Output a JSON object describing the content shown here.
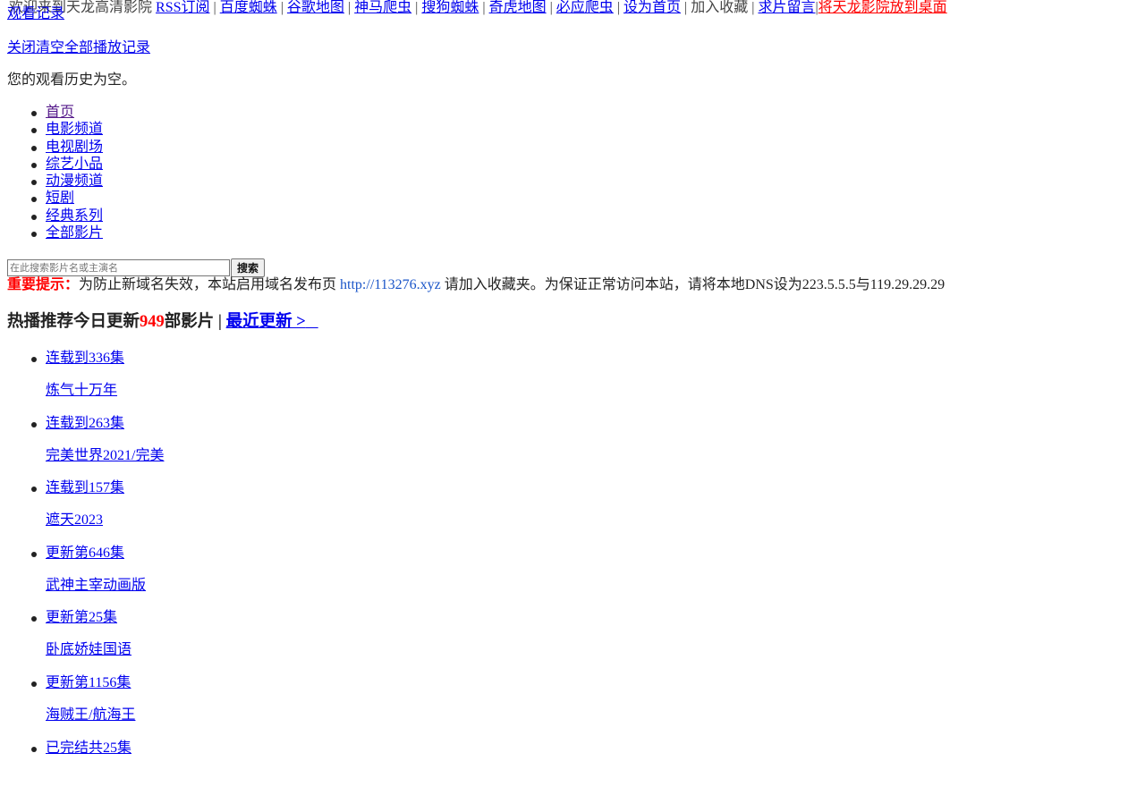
{
  "topbar": {
    "welcome": "欢迎来到天龙高清影院",
    "links": [
      "RSS订阅",
      "百度蜘蛛",
      "谷歌地图",
      "神马爬虫",
      "搜狗蜘蛛",
      "奇虎地图",
      "必应爬虫",
      "设为首页"
    ],
    "bookmark": "加入收藏",
    "request": "求片留言",
    "desktop": "将天龙影院放到桌面"
  },
  "history": {
    "label": "观看记录",
    "close": "关闭",
    "clear": "清空全部播放记录",
    "empty": "您的观看历史为空。"
  },
  "nav": {
    "items": [
      "首页",
      "电影频道",
      "电视剧场",
      "综艺小品",
      "动漫频道",
      "短剧",
      "经典系列",
      "全部影片"
    ]
  },
  "search": {
    "placeholder": "在此搜索影片名或主演名",
    "button": "搜索"
  },
  "notice": {
    "label": "重要提示：",
    "text_before": "为防止新域名失效，本站启用域名发布页",
    "url": "http://113276.xyz",
    "text_after": "请加入收藏夹。为保证正常访问本站，请将本地DNS设为223.5.5.5与119.29.29.29"
  },
  "hot": {
    "prefix": "热播推荐今日更新",
    "count": "949",
    "suffix": "部影片 |",
    "recent": "最近更新 >",
    "items": [
      {
        "status": "连载到336集",
        "title": "炼气十万年"
      },
      {
        "status": "连载到263集",
        "title": "完美世界2021/完美"
      },
      {
        "status": "连载到157集",
        "title": "遮天2023"
      },
      {
        "status": "更新第646集",
        "title": "武神主宰动画版"
      },
      {
        "status": "更新第25集",
        "title": "卧底娇娃国语"
      },
      {
        "status": "更新第1156集",
        "title": "海贼王/航海王"
      },
      {
        "status": "已完结共25集",
        "title": ""
      }
    ]
  }
}
